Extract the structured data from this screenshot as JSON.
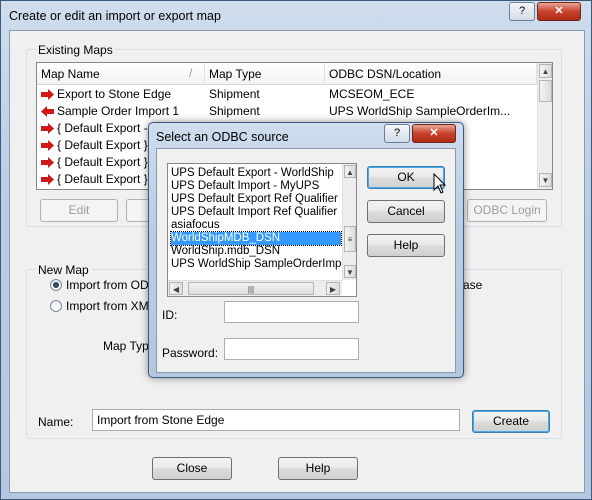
{
  "window": {
    "title": "Create or edit an import or export map",
    "help_glyph": "?",
    "close_glyph": "✕"
  },
  "existing_maps": {
    "legend": "Existing Maps",
    "columns": [
      "Map Name",
      "Map Type",
      "ODBC DSN/Location"
    ],
    "rows": [
      {
        "name": "Export to Stone Edge",
        "type": "Shipment",
        "location": "MCSEOM_ECE",
        "direction": "export"
      },
      {
        "name": "Sample Order Import 1",
        "type": "Shipment",
        "location": "UPS WorldShip SampleOrderIm...",
        "direction": "import"
      },
      {
        "name": "{ Default Export - W",
        "type": "",
        "location": "",
        "direction": "export"
      },
      {
        "name": "{ Default Export }",
        "type": "",
        "location": "",
        "direction": "export"
      },
      {
        "name": "{ Default Export }",
        "type": "",
        "location": "",
        "direction": "export"
      },
      {
        "name": "{ Default Export }",
        "type": "",
        "location": "",
        "direction": "export"
      }
    ],
    "buttons": {
      "edit": "Edit",
      "odbc_login": "ODBC Login"
    }
  },
  "new_map": {
    "legend": "New Map",
    "radio_odbc": "Import from ODBC",
    "radio_xml": "Import from XML",
    "map_type_label": "Map Type",
    "right_fragment": "ase"
  },
  "name_field": {
    "label": "Name:",
    "value": "Import from Stone Edge"
  },
  "buttons": {
    "create": "Create",
    "close": "Close",
    "help": "Help"
  },
  "odbc_dialog": {
    "title": "Select an ODBC source",
    "help_glyph": "?",
    "close_glyph": "✕",
    "sources": [
      "UPS Default Export - WorldShip",
      "UPS Default Import - MyUPS",
      "UPS Default Export Ref Qualifier",
      "UPS Default Import Ref Qualifier",
      "asiafocus",
      "WorldShipMDB_DSN",
      "WorldShip.mdb_DSN",
      "UPS WorldShip SampleOrderImport"
    ],
    "selected": "WorldShipMDB_DSN",
    "id_label": "ID:",
    "id_value": "",
    "password_label": "Password:",
    "password_value": "",
    "ok": "OK",
    "cancel": "Cancel",
    "help": "Help"
  },
  "colors": {
    "selection": "#3399ff",
    "export_arrow": "#d01818",
    "import_arrow": "#d01818",
    "title_bar": "#b9cde4"
  }
}
